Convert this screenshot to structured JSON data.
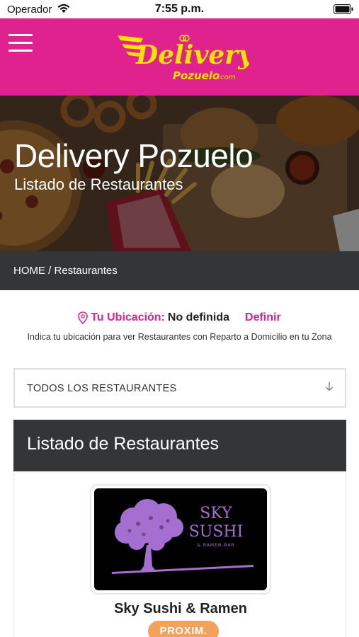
{
  "status_bar": {
    "carrier": "Operador",
    "time": "7:55 p.m."
  },
  "header": {
    "logo_main": "Delivery",
    "logo_sub": "Pozuelo",
    "logo_suffix": ".com"
  },
  "hero": {
    "title": "Delivery Pozuelo",
    "subtitle": "Listado de Restaurantes"
  },
  "breadcrumb": {
    "home": "HOME",
    "separator": " / ",
    "current": "Restaurantes"
  },
  "location": {
    "label": "Tu Ubicación:",
    "value": "No definida",
    "action": "Definir",
    "help": "Indica tu ubicación para ver Restaurantes con Reparto a Domicilio en tu Zona"
  },
  "filter": {
    "selected": "TODOS LOS RESTAURANTES"
  },
  "listing": {
    "title": "Listado de Restaurantes",
    "restaurants": [
      {
        "name": "Sky Sushi & Ramen",
        "logo_line1": "SKY",
        "logo_line2": "SUSHI",
        "logo_line3": "& RAMEN BAR",
        "badge": "PROXIM."
      }
    ]
  },
  "colors": {
    "brand": "#e0228f",
    "dark": "#333537",
    "badge": "#f2a25a",
    "logo_yellow": "#ffe300",
    "logo_purple": "#a46fd0"
  }
}
